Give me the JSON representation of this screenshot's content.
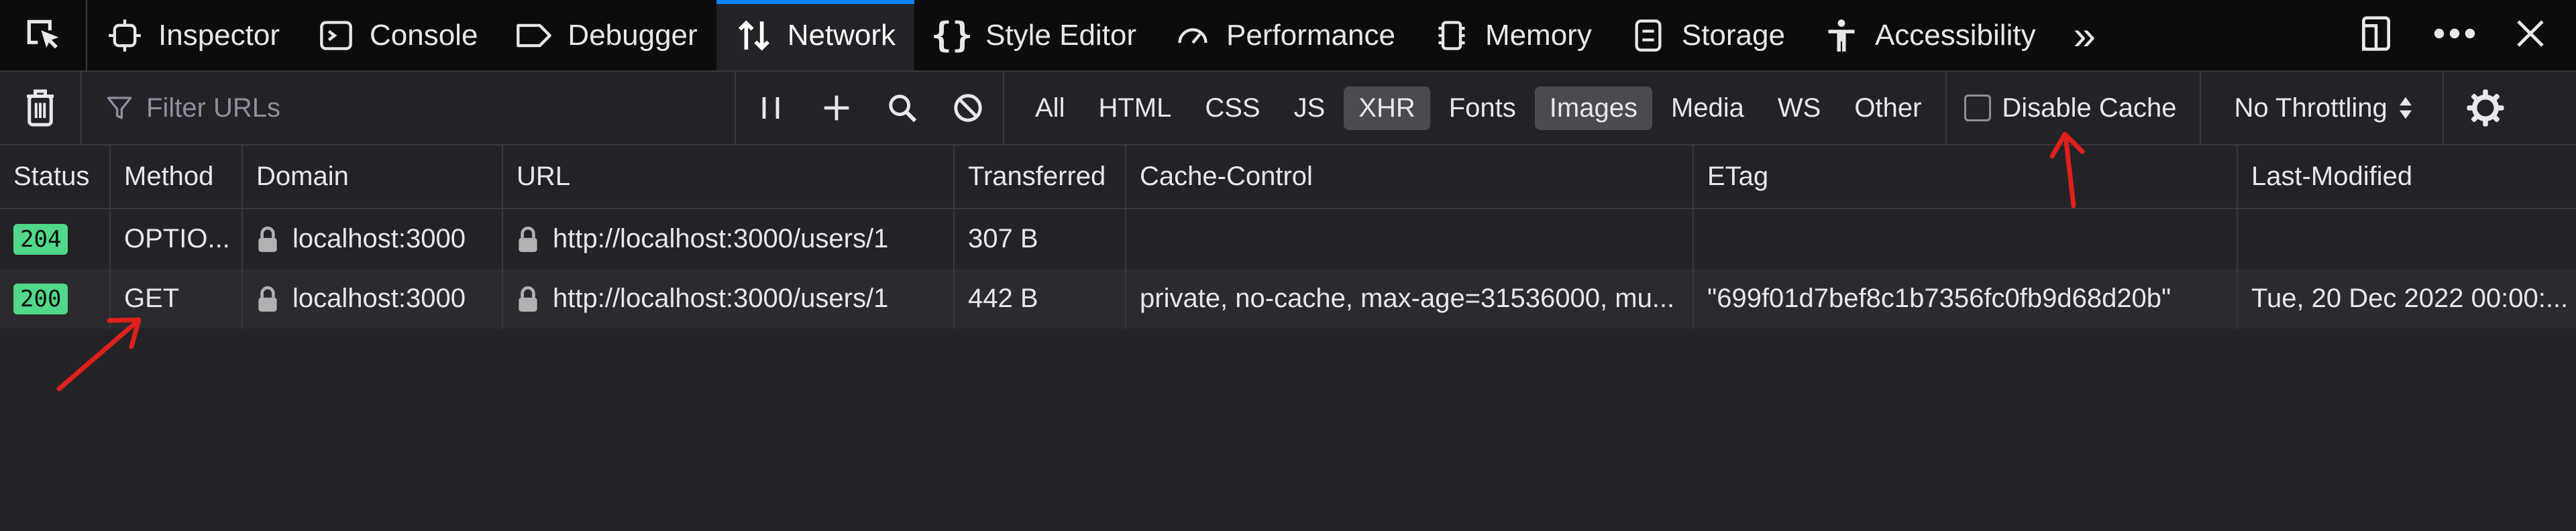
{
  "tabs": [
    {
      "id": "inspector",
      "label": "Inspector",
      "icon": "inspector-icon"
    },
    {
      "id": "console",
      "label": "Console",
      "icon": "console-icon"
    },
    {
      "id": "debugger",
      "label": "Debugger",
      "icon": "debugger-icon"
    },
    {
      "id": "network",
      "label": "Network",
      "icon": "network-icon",
      "selected": true
    },
    {
      "id": "style-editor",
      "label": "Style Editor",
      "icon": "braces-icon"
    },
    {
      "id": "performance",
      "label": "Performance",
      "icon": "gauge-icon"
    },
    {
      "id": "memory",
      "label": "Memory",
      "icon": "memory-chip-icon"
    },
    {
      "id": "storage",
      "label": "Storage",
      "icon": "storage-icon"
    },
    {
      "id": "accessibility",
      "label": "Accessibility",
      "icon": "accessibility-icon"
    }
  ],
  "toolbar": {
    "filter_placeholder": "Filter URLs",
    "types": [
      {
        "label": "All",
        "active": false
      },
      {
        "label": "HTML",
        "active": false
      },
      {
        "label": "CSS",
        "active": false
      },
      {
        "label": "JS",
        "active": false
      },
      {
        "label": "XHR",
        "active": true
      },
      {
        "label": "Fonts",
        "active": false
      },
      {
        "label": "Images",
        "active": true
      },
      {
        "label": "Media",
        "active": false
      },
      {
        "label": "WS",
        "active": false
      },
      {
        "label": "Other",
        "active": false
      }
    ],
    "disable_cache_label": "Disable Cache",
    "throttling_label": "No Throttling"
  },
  "table": {
    "columns": [
      "Status",
      "Method",
      "Domain",
      "URL",
      "Transferred",
      "Cache-Control",
      "ETag",
      "Last-Modified"
    ],
    "rows": [
      {
        "status": "204",
        "method": "OPTIO...",
        "domain": "localhost:3000",
        "url": "http://localhost:3000/users/1",
        "transferred": "307 B",
        "cache_control": "",
        "etag": "",
        "last_modified": ""
      },
      {
        "status": "200",
        "method": "GET",
        "domain": "localhost:3000",
        "url": "http://localhost:3000/users/1",
        "transferred": "442 B",
        "cache_control": "private, no-cache, max-age=31536000, mu...",
        "etag": "\"699f01d7bef8c1b7356fc0fb9d68d20b\"",
        "last_modified": "Tue, 20 Dec 2022 00:00:..."
      }
    ]
  },
  "colors": {
    "accent": "#0a84ff",
    "status_ok": "#51d88a",
    "annotation": "#e0201b"
  }
}
